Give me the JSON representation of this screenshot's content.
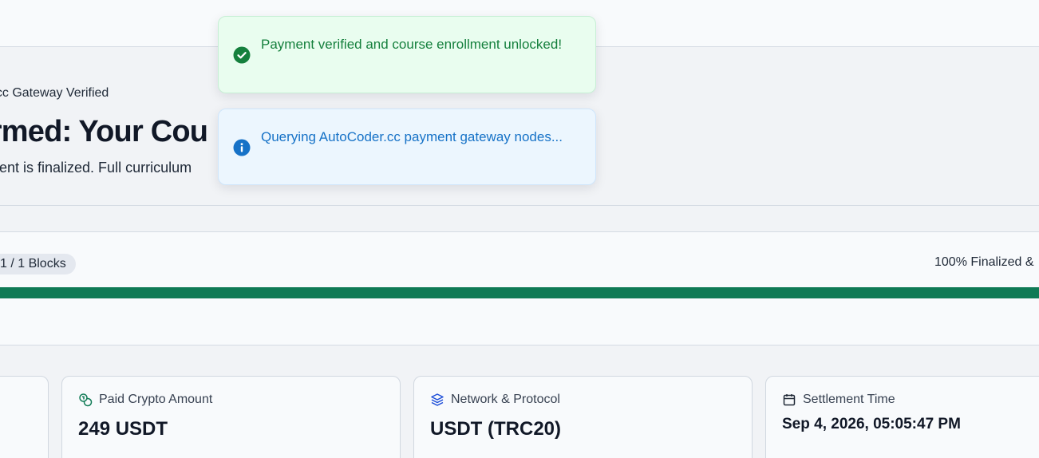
{
  "hero": {
    "kicker": "r.cc Gateway Verified",
    "title": "irmed: Your Cou",
    "subtitle": "ment is finalized. Full curriculum"
  },
  "progress": {
    "blocks_label": "1 / 1 Blocks",
    "status_label": "100% Finalized &",
    "fill_percent": 100,
    "fill_color": "#0f7a55"
  },
  "cards": [
    {
      "icon": "coins-icon",
      "label": "Paid Crypto Amount",
      "value": "249 USDT"
    },
    {
      "icon": "layers-icon",
      "label": "Network & Protocol",
      "value": "USDT (TRC20)"
    },
    {
      "icon": "calendar-icon",
      "label": "Settlement Time",
      "value": "Sep 4, 2026, 05:05:47 PM"
    }
  ],
  "toasts": [
    {
      "type": "success",
      "icon": "check-circle-icon",
      "message": "Payment verified and course enrollment unlocked!"
    },
    {
      "type": "info",
      "icon": "info-circle-icon",
      "message": "Querying AutoCoder.cc payment gateway nodes..."
    }
  ]
}
